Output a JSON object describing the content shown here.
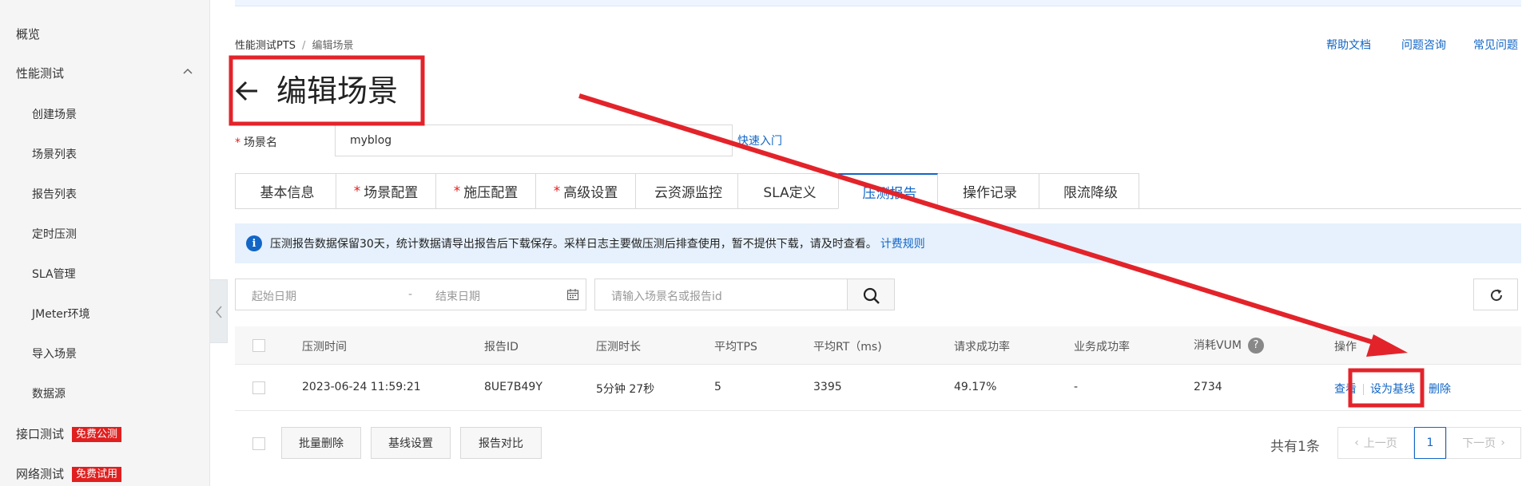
{
  "sidebar": {
    "items": [
      {
        "label": "概览"
      },
      {
        "label": "性能测试"
      },
      {
        "label": "创建场景"
      },
      {
        "label": "场景列表"
      },
      {
        "label": "报告列表"
      },
      {
        "label": "定时压测"
      },
      {
        "label": "SLA管理"
      },
      {
        "label": "JMeter环境"
      },
      {
        "label": "导入场景"
      },
      {
        "label": "数据源"
      },
      {
        "label": "接口测试",
        "badge": "免费公测"
      },
      {
        "label": "网络测试",
        "badge": "免费试用"
      }
    ]
  },
  "breadcrumb": {
    "root": "性能测试PTS",
    "separator": "/",
    "current": "编辑场景"
  },
  "help_links": {
    "docs": "帮助文档",
    "consult": "问题咨询",
    "faq": "常见问题"
  },
  "page": {
    "title": "编辑场景"
  },
  "form": {
    "required_mark": "*",
    "name_label": "场景名",
    "name_value": "myblog",
    "quick_start": "快速入门"
  },
  "tabs": [
    {
      "label": "基本信息",
      "required": ""
    },
    {
      "label": "场景配置",
      "required": "*"
    },
    {
      "label": "施压配置",
      "required": "*"
    },
    {
      "label": "高级设置",
      "required": "*"
    },
    {
      "label": "云资源监控",
      "required": ""
    },
    {
      "label": "SLA定义",
      "required": ""
    },
    {
      "label": "压测报告",
      "required": "",
      "active": true
    },
    {
      "label": "操作记录",
      "required": ""
    },
    {
      "label": "限流降级",
      "required": ""
    }
  ],
  "notice": {
    "text": "压测报告数据保留30天，统计数据请导出报告后下载保存。采样日志主要做压测后排查使用，暂不提供下载，请及时查看。",
    "link": "计费规则"
  },
  "filters": {
    "start_date": "起始日期",
    "dash": "-",
    "end_date": "结束日期",
    "search_placeholder": "请输入场景名或报告id"
  },
  "table": {
    "headers": {
      "time": "压测时间",
      "id": "报告ID",
      "duration": "压测时长",
      "tps": "平均TPS",
      "rt": "平均RT（ms)",
      "req_success": "请求成功率",
      "biz_success": "业务成功率",
      "vum": "消耗VUM",
      "vum_help": "?",
      "ops": "操作"
    },
    "rows": [
      {
        "time": "2023-06-24 11:59:21",
        "id": "8UE7B49Y",
        "duration": "5分钟 27秒",
        "tps": "5",
        "rt": "3395",
        "req_success": "49.17%",
        "biz_success": "-",
        "vum": "2734",
        "ops": {
          "view": "查看",
          "baseline": "设为基线",
          "delete": "删除"
        }
      }
    ]
  },
  "bottom": {
    "batch_delete": "批量删除",
    "baseline_settings": "基线设置",
    "report_compare": "报告对比"
  },
  "pagination": {
    "total": "共有1条",
    "prev": "上一页",
    "current": "1",
    "next": "下一页"
  },
  "colors": {
    "accent": "#1266c6",
    "annotation": "#e3232a",
    "badge": "#e02020"
  },
  "icons": [
    "chevron-up-icon",
    "chevron-left-icon",
    "back-arrow-icon",
    "info-icon",
    "calendar-icon",
    "search-icon",
    "refresh-icon",
    "help-icon"
  ]
}
